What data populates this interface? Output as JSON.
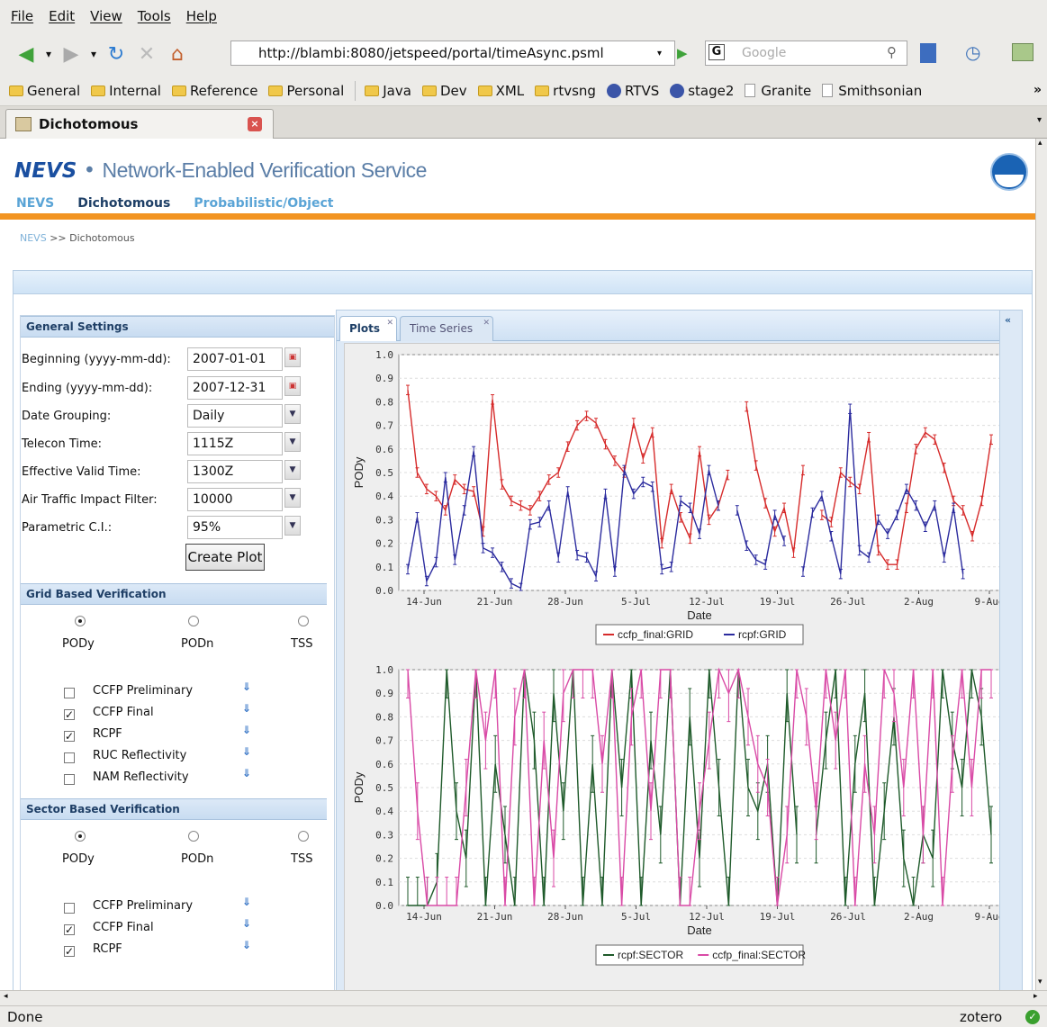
{
  "menubar": {
    "items": [
      "File",
      "Edit",
      "View",
      "Tools",
      "Help"
    ]
  },
  "navbar": {
    "url": "http://blambi:8080/jetspeed/portal/timeAsync.psml",
    "search_placeholder": "Google"
  },
  "bookmarks": [
    {
      "label": "General",
      "icon": "folder-icon"
    },
    {
      "label": "Internal",
      "icon": "folder-icon"
    },
    {
      "label": "Reference",
      "icon": "folder-icon"
    },
    {
      "label": "Personal",
      "icon": "folder-icon"
    },
    {
      "label": "Java",
      "icon": "folder-icon"
    },
    {
      "label": "Dev",
      "icon": "folder-icon"
    },
    {
      "label": "XML",
      "icon": "folder-icon"
    },
    {
      "label": "rtvsng",
      "icon": "folder-icon"
    },
    {
      "label": "RTVS",
      "icon": "globe-icon"
    },
    {
      "label": "stage2",
      "icon": "globe-icon"
    },
    {
      "label": "Granite",
      "icon": "page-icon"
    },
    {
      "label": "Smithsonian",
      "icon": "page-icon"
    }
  ],
  "tab": {
    "title": "Dichotomous"
  },
  "header": {
    "logo": "NEVS",
    "tagline": "Network-Enabled Verification Service",
    "nav": [
      "NEVS",
      "Dichotomous",
      "Probabilistic/Object"
    ],
    "breadcrumb": [
      "NEVS",
      ">>",
      "Dichotomous"
    ]
  },
  "general_settings": {
    "title": "General Settings",
    "fields": [
      {
        "label": "Beginning (yyyy-mm-dd):",
        "value": "2007-01-01",
        "control": "date"
      },
      {
        "label": "Ending (yyyy-mm-dd):",
        "value": "2007-12-31",
        "control": "date"
      },
      {
        "label": "Date Grouping:",
        "value": "Daily",
        "control": "select"
      },
      {
        "label": "Telecon Time:",
        "value": "1115Z",
        "control": "select"
      },
      {
        "label": "Effective Valid Time:",
        "value": "1300Z",
        "control": "select"
      },
      {
        "label": "Air Traffic Impact Filter:",
        "value": "10000",
        "control": "select"
      },
      {
        "label": "Parametric C.I.:",
        "value": "95%",
        "control": "select"
      }
    ],
    "button": "Create Plot"
  },
  "grid_verification": {
    "title": "Grid Based Verification",
    "radios": [
      {
        "label": "PODy",
        "checked": true
      },
      {
        "label": "PODn",
        "checked": false
      },
      {
        "label": "TSS",
        "checked": false
      }
    ],
    "checks": [
      {
        "label": "CCFP Preliminary",
        "checked": false
      },
      {
        "label": "CCFP Final",
        "checked": true
      },
      {
        "label": "RCPF",
        "checked": true
      },
      {
        "label": "RUC Reflectivity",
        "checked": false
      },
      {
        "label": "NAM Reflectivity",
        "checked": false
      }
    ]
  },
  "sector_verification": {
    "title": "Sector Based Verification",
    "radios": [
      {
        "label": "PODy",
        "checked": true
      },
      {
        "label": "PODn",
        "checked": false
      },
      {
        "label": "TSS",
        "checked": false
      }
    ],
    "checks": [
      {
        "label": "CCFP Preliminary",
        "checked": false
      },
      {
        "label": "CCFP Final",
        "checked": true
      },
      {
        "label": "RCPF",
        "checked": true
      }
    ]
  },
  "plot_tabs": [
    "Plots",
    "Time Series"
  ],
  "status": {
    "text": "Done",
    "addon": "zotero"
  },
  "colors": {
    "accent": "#f29421",
    "red_series": "#d62b2b",
    "blue_series": "#2b2b9e",
    "green_series": "#1e5a2a",
    "pink_series": "#d94aa6"
  },
  "chart_data": [
    {
      "type": "line",
      "xlabel": "Date",
      "ylabel": "PODy",
      "ylim": [
        0,
        1.0
      ],
      "x_ticks": [
        "14-Jun",
        "21-Jun",
        "28-Jun",
        "5-Jul",
        "12-Jul",
        "19-Jul",
        "26-Jul",
        "2-Aug",
        "9-Aug"
      ],
      "y_ticks": [
        "0.0",
        "0.1",
        "0.2",
        "0.3",
        "0.4",
        "0.5",
        "0.6",
        "0.7",
        "0.8",
        "0.9",
        "1.0"
      ],
      "legend": "bottom",
      "x_day_start": "2007-06-11",
      "series": [
        {
          "name": "ccfp_final:GRID",
          "color": "#d62b2b",
          "values": [
            0.85,
            0.5,
            0.43,
            0.4,
            0.34,
            0.47,
            0.43,
            0.42,
            0.25,
            0.81,
            0.45,
            0.38,
            0.36,
            0.34,
            0.4,
            0.47,
            0.5,
            0.61,
            0.7,
            0.74,
            0.71,
            0.62,
            0.55,
            0.5,
            0.71,
            0.56,
            0.67,
            0.2,
            0.43,
            0.31,
            0.22,
            0.59,
            0.3,
            0.36,
            0.49,
            null,
            0.78,
            0.53,
            0.37,
            0.25,
            0.35,
            0.16,
            0.51,
            null,
            0.32,
            0.29,
            0.5,
            0.46,
            0.43,
            0.65,
            0.17,
            0.11,
            0.11,
            0.35,
            0.6,
            0.67,
            0.64,
            0.52,
            0.38,
            0.34,
            0.23,
            0.38,
            0.64
          ]
        },
        {
          "name": "rcpf:GRID",
          "color": "#2b2b9e",
          "values": [
            0.09,
            0.31,
            0.04,
            0.12,
            0.48,
            0.13,
            0.34,
            0.59,
            0.18,
            0.16,
            0.1,
            0.03,
            0.01,
            0.28,
            0.29,
            0.36,
            0.14,
            0.42,
            0.15,
            0.14,
            0.06,
            0.41,
            0.08,
            0.51,
            0.41,
            0.46,
            0.44,
            0.09,
            0.1,
            0.38,
            0.35,
            0.24,
            0.51,
            0.36,
            null,
            0.34,
            0.19,
            0.13,
            0.11,
            0.32,
            0.21,
            null,
            0.08,
            0.33,
            0.4,
            0.23,
            0.07,
            0.77,
            0.17,
            0.14,
            0.3,
            0.24,
            0.32,
            0.43,
            0.36,
            0.27,
            0.36,
            0.14,
            0.35,
            0.07
          ]
        }
      ]
    },
    {
      "type": "line",
      "xlabel": "Date",
      "ylabel": "PODy",
      "ylim": [
        0,
        1.0
      ],
      "x_ticks": [
        "14-Jun",
        "21-Jun",
        "28-Jun",
        "5-Jul",
        "12-Jul",
        "19-Jul",
        "26-Jul",
        "2-Aug",
        "9-Aug"
      ],
      "y_ticks": [
        "0.0",
        "0.1",
        "0.2",
        "0.3",
        "0.4",
        "0.5",
        "0.6",
        "0.7",
        "0.8",
        "0.9",
        "1.0"
      ],
      "legend": "bottom",
      "series": [
        {
          "name": "rcpf:SECTOR",
          "color": "#1e5a2a",
          "values": [
            0.0,
            0.0,
            0.0,
            0.1,
            1.0,
            0.4,
            0.2,
            1.0,
            0.0,
            0.6,
            0.3,
            0.0,
            1.0,
            0.7,
            0.0,
            0.9,
            0.4,
            1.0,
            0.0,
            0.6,
            0.0,
            1.0,
            0.5,
            1.0,
            0.0,
            0.7,
            0.3,
            1.0,
            0.0,
            0.8,
            0.2,
            1.0,
            0.5,
            0.0,
            1.0,
            0.5,
            0.4,
            0.6,
            0.0,
            0.9,
            0.3,
            null,
            0.3,
            0.7,
            1.0,
            0.0,
            0.6,
            0.9,
            0.0,
            0.4,
            0.8,
            0.2,
            0.0,
            0.3,
            0.2,
            1.0,
            0.7,
            0.5,
            1.0,
            0.8,
            0.3
          ]
        },
        {
          "name": "ccfp_final:SECTOR",
          "color": "#d94aa6",
          "values": [
            1.0,
            0.4,
            0.0,
            0.0,
            0.0,
            0.0,
            0.5,
            1.0,
            0.7,
            1.0,
            0.0,
            0.8,
            1.0,
            0.0,
            0.7,
            0.2,
            0.9,
            1.0,
            1.0,
            1.0,
            0.6,
            1.0,
            0.0,
            0.8,
            1.0,
            0.4,
            1.0,
            1.0,
            0.0,
            0.0,
            0.4,
            0.7,
            1.0,
            0.9,
            1.0,
            0.8,
            0.6,
            0.5,
            0.0,
            0.3,
            1.0,
            0.8,
            0.4,
            1.0,
            0.7,
            1.0,
            0.0,
            0.6,
            0.3,
            1.0,
            0.9,
            0.5,
            1.0,
            0.3,
            1.0,
            0.0,
            0.6,
            1.0,
            0.5,
            1.0,
            1.0
          ]
        }
      ]
    }
  ]
}
